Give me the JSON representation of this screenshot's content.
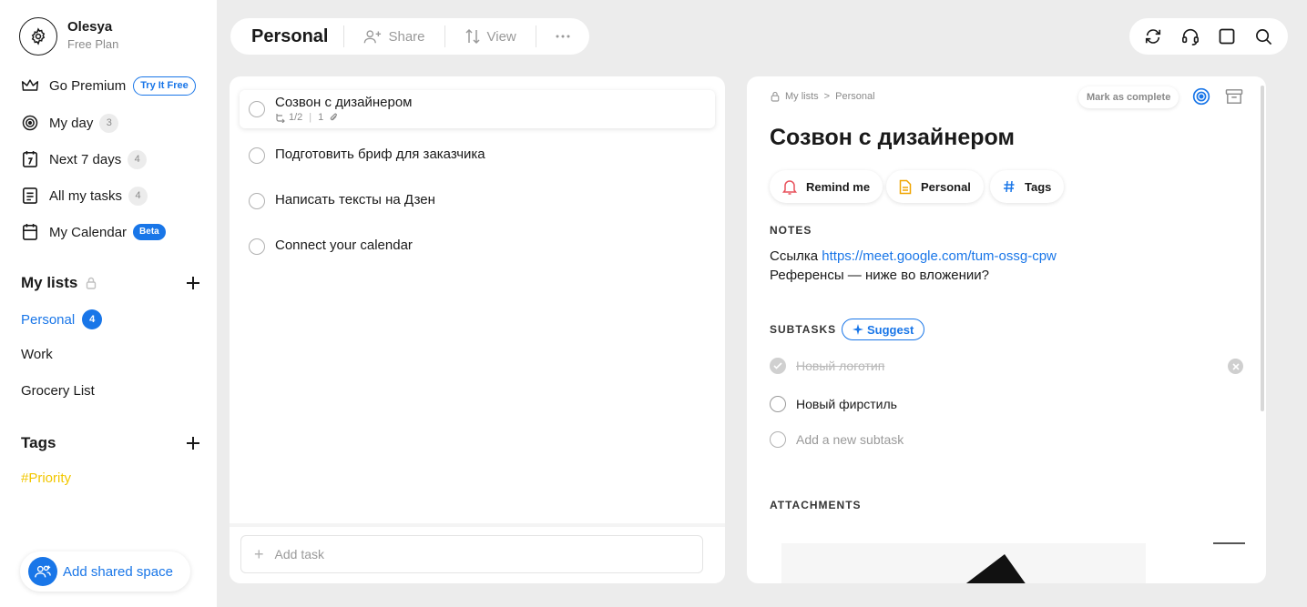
{
  "profile": {
    "name": "Olesya",
    "plan": "Free Plan"
  },
  "nav": {
    "go_premium": "Go Premium",
    "try_free": "Try It Free",
    "my_day": "My day",
    "my_day_count": "3",
    "next7": "Next 7 days",
    "next7_count": "4",
    "all_tasks": "All my tasks",
    "all_tasks_count": "4",
    "calendar": "My Calendar",
    "calendar_badge": "Beta"
  },
  "lists": {
    "heading": "My lists",
    "items": [
      {
        "label": "Personal",
        "count": "4"
      },
      {
        "label": "Work"
      },
      {
        "label": "Grocery List"
      }
    ]
  },
  "tags": {
    "heading": "Tags",
    "items": [
      "#Priority"
    ],
    "tag_color": "#f2c700"
  },
  "shared_space": "Add shared space",
  "toolbar": {
    "title": "Personal",
    "share": "Share",
    "view": "View",
    "more": "···"
  },
  "tasks": [
    {
      "title": "Созвон с дизайнером",
      "subtasks": "1/2",
      "attachments": "1"
    },
    {
      "title": "Подготовить бриф для заказчика"
    },
    {
      "title": "Написать тексты на Дзен"
    },
    {
      "title": "Connect your calendar"
    }
  ],
  "add_task_placeholder": "Add task",
  "detail": {
    "crumb_root": "My lists",
    "crumb_sep": ">",
    "crumb_list": "Personal",
    "mark_complete": "Mark as complete",
    "title": "Созвон с дизайнером",
    "chips": {
      "remind": "Remind me",
      "list": "Personal",
      "tags": "Tags"
    },
    "notes_label": "NOTES",
    "notes_prefix": "Ссылка ",
    "notes_link": "https://meet.google.com/tum-ossg-cpw",
    "notes_line2": "Референсы — ниже во вложении?",
    "subtasks_label": "SUBTASKS",
    "suggest": "Suggest",
    "subtasks": [
      {
        "title": "Новый логотип",
        "done": true
      },
      {
        "title": "Новый фирстиль",
        "done": false
      }
    ],
    "add_subtask": "Add a new subtask",
    "attachments_label": "ATTACHMENTS"
  },
  "colors": {
    "accent": "#1976e8",
    "background": "#ececec",
    "remind_icon": "#e8505b",
    "list_icon": "#f0a500"
  },
  "icons": [
    "gear-icon",
    "crown-icon",
    "target-icon",
    "calendar-7-icon",
    "list-icon",
    "calendar-icon",
    "lock-icon",
    "plus-icon",
    "add-user-icon",
    "sort-icon",
    "more-icon",
    "sync-icon",
    "headset-icon",
    "square-icon",
    "search-icon",
    "subtask-icon",
    "paperclip-icon",
    "bell-icon",
    "note-icon",
    "hash-icon",
    "archive-icon",
    "sparkle-icon",
    "close-icon",
    "people-icon"
  ]
}
